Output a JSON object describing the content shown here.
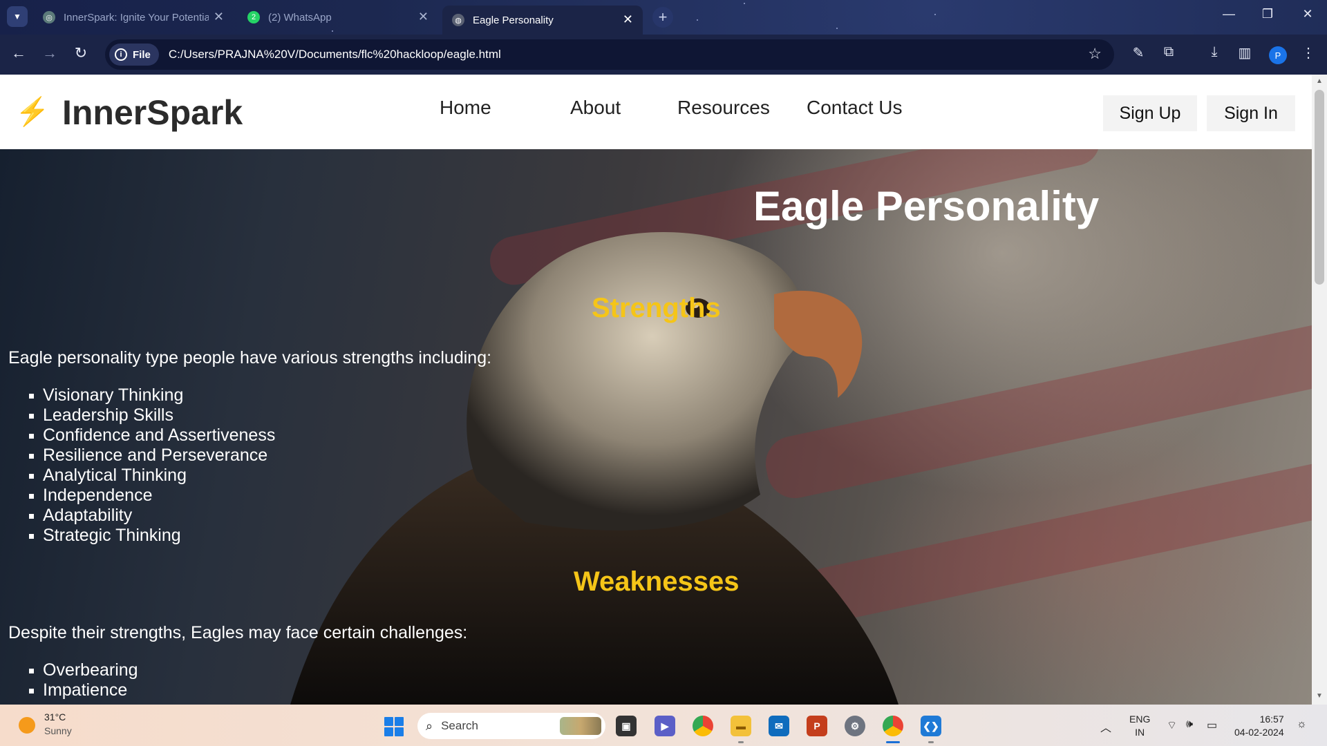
{
  "browser": {
    "tabs": [
      {
        "title": "InnerSpark: Ignite Your Potentia",
        "active": false
      },
      {
        "title": "(2) WhatsApp",
        "active": false,
        "badge": "2"
      },
      {
        "title": "Eagle Personality",
        "active": true
      }
    ],
    "address": {
      "scheme_label": "File",
      "url": "C:/Users/PRAJNA%20V/Documents/flc%20hackloop/eagle.html"
    },
    "profile_initial": "P"
  },
  "site": {
    "logo_text": "InnerSpark",
    "nav": [
      "Home",
      "About",
      "Resources",
      "Contact Us"
    ],
    "sign_up": "Sign Up",
    "sign_in": "Sign In"
  },
  "content": {
    "title": "Eagle Personality",
    "strengths": {
      "heading": "Strengths",
      "intro": "Eagle personality type people have various strengths including:",
      "items": [
        "Visionary Thinking",
        "Leadership Skills",
        "Confidence and Assertiveness",
        "Resilience and Perseverance",
        "Analytical Thinking",
        "Independence",
        "Adaptability",
        "Strategic Thinking"
      ]
    },
    "weaknesses": {
      "heading": "Weaknesses",
      "intro": "Despite their strengths, Eagles may face certain challenges:",
      "items": [
        "Overbearing",
        "Impatience"
      ]
    }
  },
  "taskbar": {
    "weather": {
      "temp": "31°C",
      "condition": "Sunny"
    },
    "search_label": "Search",
    "language": {
      "line1": "ENG",
      "line2": "IN"
    },
    "time": "16:57",
    "date": "04-02-2024"
  },
  "colors": {
    "accent_heading": "#f5c518",
    "browser_frame": "#1b2447"
  }
}
